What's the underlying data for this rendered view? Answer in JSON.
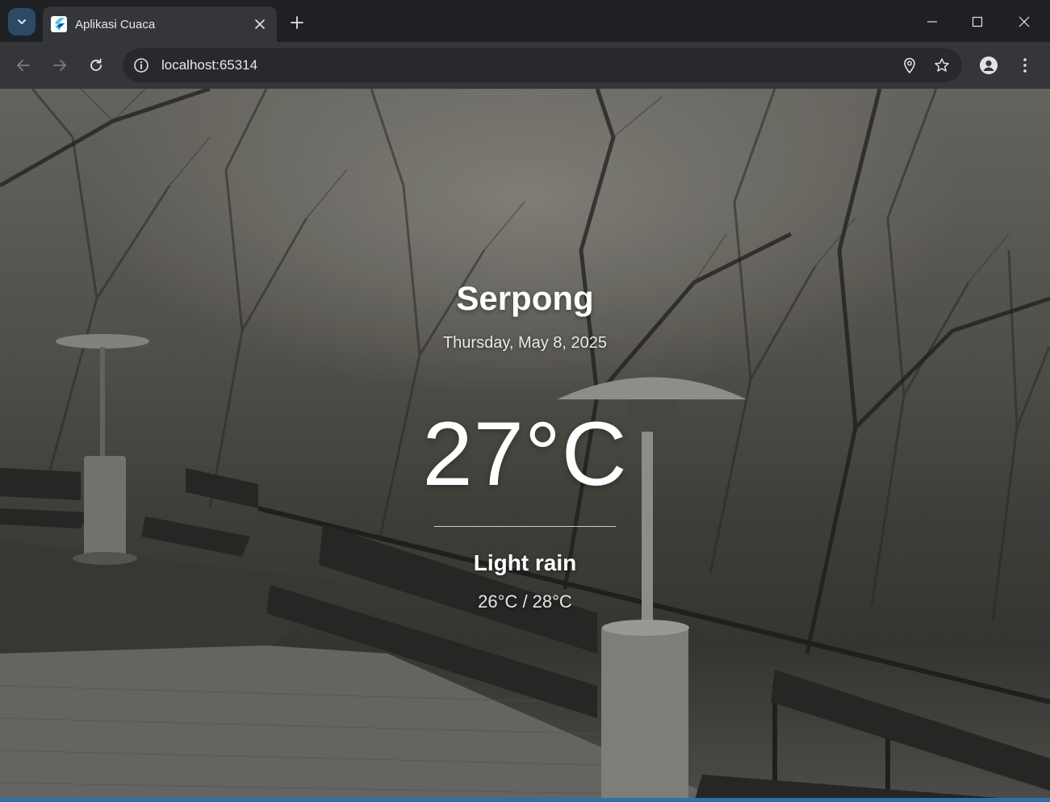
{
  "browser": {
    "tab": {
      "title": "Aplikasi Cuaca"
    },
    "address_bar": {
      "url": "localhost:65314"
    }
  },
  "weather": {
    "city": "Serpong",
    "date": "Thursday, May 8, 2025",
    "temperature": "27°C",
    "condition": "Light rain",
    "range": "26°C / 28°C"
  },
  "colors": {
    "tab_bar": "#1f2023",
    "toolbar": "#35363a",
    "omnibox": "#28292c",
    "text_primary": "#ffffff"
  },
  "icons": {
    "tab_search": "chevron-down-icon",
    "favicon": "flutter-logo-icon",
    "tab_close": "close-icon",
    "new_tab": "plus-icon",
    "minimize": "minimize-icon",
    "maximize": "maximize-icon",
    "close_window": "close-icon",
    "back": "arrow-left-icon",
    "forward": "arrow-right-icon",
    "reload": "reload-icon",
    "site_info": "info-icon",
    "location": "location-pin-icon",
    "bookmark": "star-icon",
    "profile": "person-icon",
    "menu": "more-vert-icon"
  }
}
